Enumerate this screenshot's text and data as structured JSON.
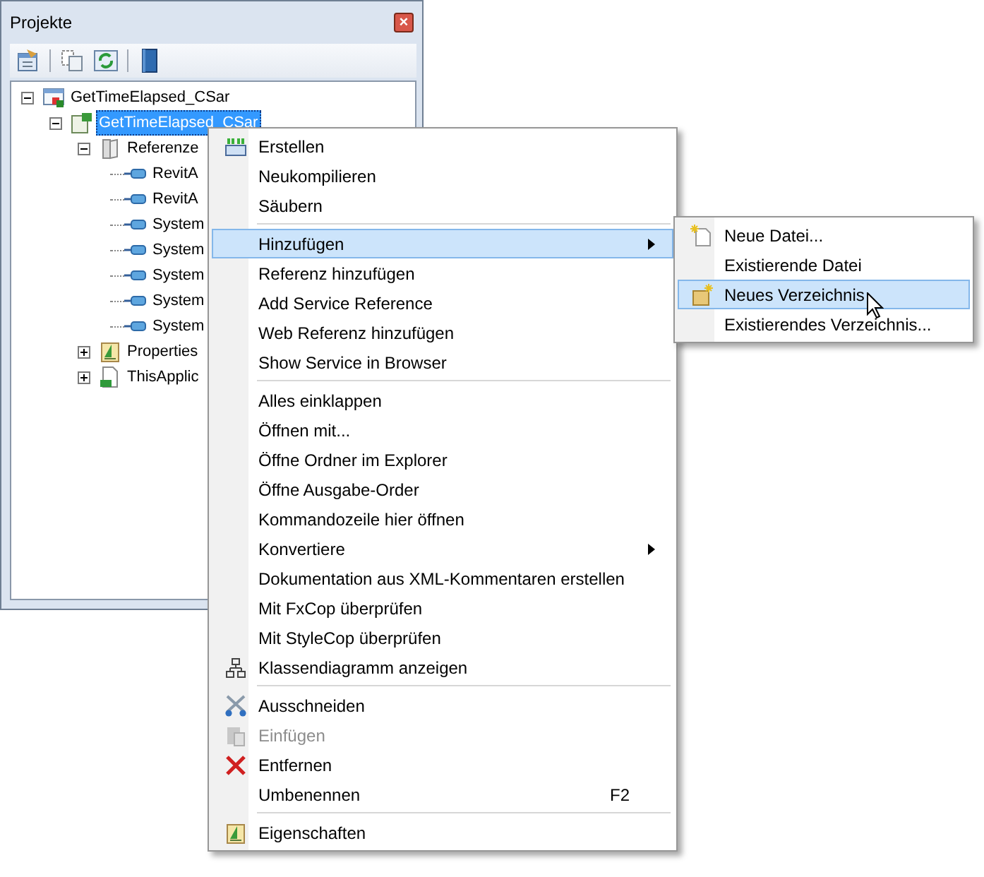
{
  "panel": {
    "title": "Projekte",
    "close": "×"
  },
  "tree": [
    {
      "label": "GetTimeElapsed_CSar",
      "kind": "solution",
      "selected": false,
      "expanded": true,
      "children": [
        {
          "label": "GetTimeElapsed_CSar",
          "kind": "project",
          "selected": true,
          "expanded": true,
          "children": [
            {
              "label": "Referenze",
              "kind": "folder",
              "selected": false,
              "expanded": true,
              "children": [
                {
                  "label": "RevitA",
                  "kind": "reference",
                  "selected": false
                },
                {
                  "label": "RevitA",
                  "kind": "reference",
                  "selected": false
                },
                {
                  "label": "System",
                  "kind": "reference",
                  "selected": false
                },
                {
                  "label": "System",
                  "kind": "reference",
                  "selected": false
                },
                {
                  "label": "System",
                  "kind": "reference",
                  "selected": false
                },
                {
                  "label": "System",
                  "kind": "reference",
                  "selected": false
                },
                {
                  "label": "System",
                  "kind": "reference",
                  "selected": false
                }
              ]
            },
            {
              "label": "Properties",
              "kind": "properties",
              "selected": false,
              "expanded": false
            },
            {
              "label": "ThisApplic",
              "kind": "file",
              "selected": false,
              "expanded": false
            }
          ]
        }
      ]
    }
  ],
  "menu": {
    "items": [
      {
        "kind": "item",
        "label": "Erstellen",
        "selected": false,
        "disabled": false
      },
      {
        "kind": "item",
        "label": "Neukompilieren",
        "selected": false,
        "disabled": false
      },
      {
        "kind": "item",
        "label": "Säubern",
        "selected": false,
        "disabled": false
      },
      {
        "kind": "separator"
      },
      {
        "kind": "item",
        "label": "Hinzufügen",
        "selected": true,
        "disabled": false,
        "submenu": true
      },
      {
        "kind": "item",
        "label": "Referenz hinzufügen",
        "selected": false,
        "disabled": false
      },
      {
        "kind": "item",
        "label": "Add Service Reference",
        "selected": false,
        "disabled": false
      },
      {
        "kind": "item",
        "label": "Web Referenz hinzufügen",
        "selected": false,
        "disabled": false
      },
      {
        "kind": "item",
        "label": "Show Service in Browser",
        "selected": false,
        "disabled": false
      },
      {
        "kind": "separator"
      },
      {
        "kind": "item",
        "label": "Alles einklappen",
        "selected": false,
        "disabled": false
      },
      {
        "kind": "item",
        "label": "Öffnen mit...",
        "selected": false,
        "disabled": false
      },
      {
        "kind": "item",
        "label": "Öffne Ordner im Explorer",
        "selected": false,
        "disabled": false
      },
      {
        "kind": "item",
        "label": "Öffne Ausgabe-Order",
        "selected": false,
        "disabled": false
      },
      {
        "kind": "item",
        "label": "Kommandozeile hier öffnen",
        "selected": false,
        "disabled": false
      },
      {
        "kind": "item",
        "label": "Konvertiere",
        "selected": false,
        "disabled": false,
        "submenu": true
      },
      {
        "kind": "item",
        "label": "Dokumentation aus XML-Kommentaren erstellen",
        "selected": false,
        "disabled": false
      },
      {
        "kind": "item",
        "label": "Mit FxCop überprüfen",
        "selected": false,
        "disabled": false
      },
      {
        "kind": "item",
        "label": "Mit StyleCop überprüfen",
        "selected": false,
        "disabled": false
      },
      {
        "kind": "item",
        "label": "Klassendiagramm anzeigen",
        "selected": false,
        "disabled": false
      },
      {
        "kind": "separator"
      },
      {
        "kind": "item",
        "label": "Ausschneiden",
        "selected": false,
        "disabled": false
      },
      {
        "kind": "item",
        "label": "Einfügen",
        "selected": false,
        "disabled": true
      },
      {
        "kind": "item",
        "label": "Entfernen",
        "selected": false,
        "disabled": false
      },
      {
        "kind": "item",
        "label": "Umbenennen",
        "selected": false,
        "disabled": false,
        "shortcut": "F2"
      },
      {
        "kind": "separator"
      },
      {
        "kind": "item",
        "label": "Eigenschaften",
        "selected": false,
        "disabled": false
      }
    ]
  },
  "submenu": {
    "items": [
      {
        "label": "Neue Datei...",
        "selected": false
      },
      {
        "label": "Existierende Datei",
        "selected": false
      },
      {
        "label": "Neues Verzeichnis",
        "selected": true
      },
      {
        "label": "Existierendes Verzeichnis...",
        "selected": false
      }
    ]
  }
}
